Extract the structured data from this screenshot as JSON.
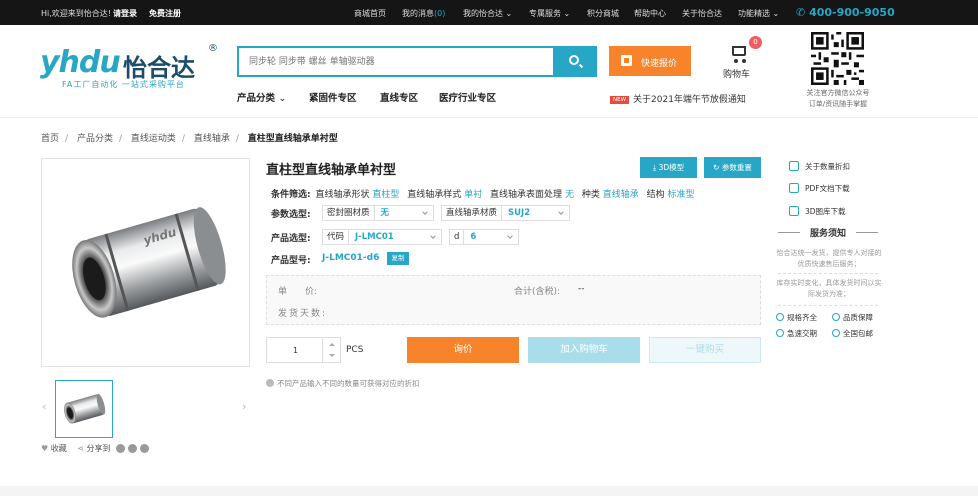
{
  "topbar": {
    "welcome": "Hi,欢迎来到怡合达!",
    "login": "请登录",
    "register": "免费注册",
    "menu": [
      "商城首页",
      "我的消息",
      "我的怡合达",
      "专属服务",
      "积分商城",
      "帮助中心",
      "关于怡合达",
      "功能精选"
    ],
    "message_count": "(0)",
    "phone": "400-900-9050"
  },
  "logo": {
    "mark": "yhdu",
    "name": "怡合达",
    "registered": "®",
    "slogan": "FA工厂自动化 一站式采购平台"
  },
  "search": {
    "placeholder": "同步轮 同步带 螺丝 单轴驱动器"
  },
  "quote_button": "快速报价",
  "cart": {
    "label": "购物车",
    "count": "0"
  },
  "qr": {
    "caption_line1": "关注官方微信公众号",
    "caption_line2": "订单/资讯随手掌握"
  },
  "nav": {
    "items": [
      "产品分类",
      "紧固件专区",
      "直线专区",
      "医疗行业专区"
    ],
    "notice_badge": "NEW",
    "notice": "关于2021年端午节放假通知"
  },
  "breadcrumb": [
    "首页",
    "产品分类",
    "直线运动类",
    "直线轴承",
    "直柱型直线轴承单衬型"
  ],
  "product": {
    "title": "直柱型直线轴承单衬型",
    "btn_3d": "3D模型",
    "btn_reset": "参数重置",
    "conditions_label": "条件筛选:",
    "conditions": [
      {
        "k": "直线轴承形状",
        "v": "直柱型"
      },
      {
        "k": "直线轴承样式",
        "v": "单衬"
      },
      {
        "k": "直线轴承表面处理",
        "v": "无"
      },
      {
        "k": "种类",
        "v": "直线轴承"
      },
      {
        "k": "结构",
        "v": "标准型"
      }
    ],
    "param_label": "参数选型:",
    "params": [
      {
        "k": "密封圈材质",
        "v": "无"
      },
      {
        "k": "直线轴承材质",
        "v": "SUJ2"
      }
    ],
    "model_label": "产品选型:",
    "models": [
      {
        "k": "代码",
        "v": "J-LMC01"
      },
      {
        "k": "d",
        "v": "6"
      }
    ],
    "pn_label": "产品型号:",
    "pn": "J-LMC01-d6",
    "copy": "复制",
    "unit_price_label": "单　　价:",
    "total_label": "合计(含税):",
    "total_value": "--",
    "ship_label": "发货天数:",
    "qty": "1",
    "qty_unit": "PCS",
    "btn_inquiry": "询价",
    "btn_cart": "加入购物车",
    "btn_buy": "一键购买",
    "hint": "不同产品输入不同的数量可获得对应的折扣",
    "collect": "收藏",
    "share": "分享到"
  },
  "sidebar": {
    "links": [
      "关于数量折扣",
      "PDF文档下载",
      "3D图库下载"
    ],
    "service_title": "服务须知",
    "service_text1": "怡合达统一发货，提供专人对接的优质快速售后服务；",
    "service_text2": "库存实时变化，具体发货时间以实际发货为准；",
    "features": [
      "规格齐全",
      "品质保障",
      "急速交期",
      "全国包邮"
    ]
  },
  "colors": {
    "accent": "#27a6c6",
    "orange": "#f7832b",
    "dark": "#151515"
  }
}
